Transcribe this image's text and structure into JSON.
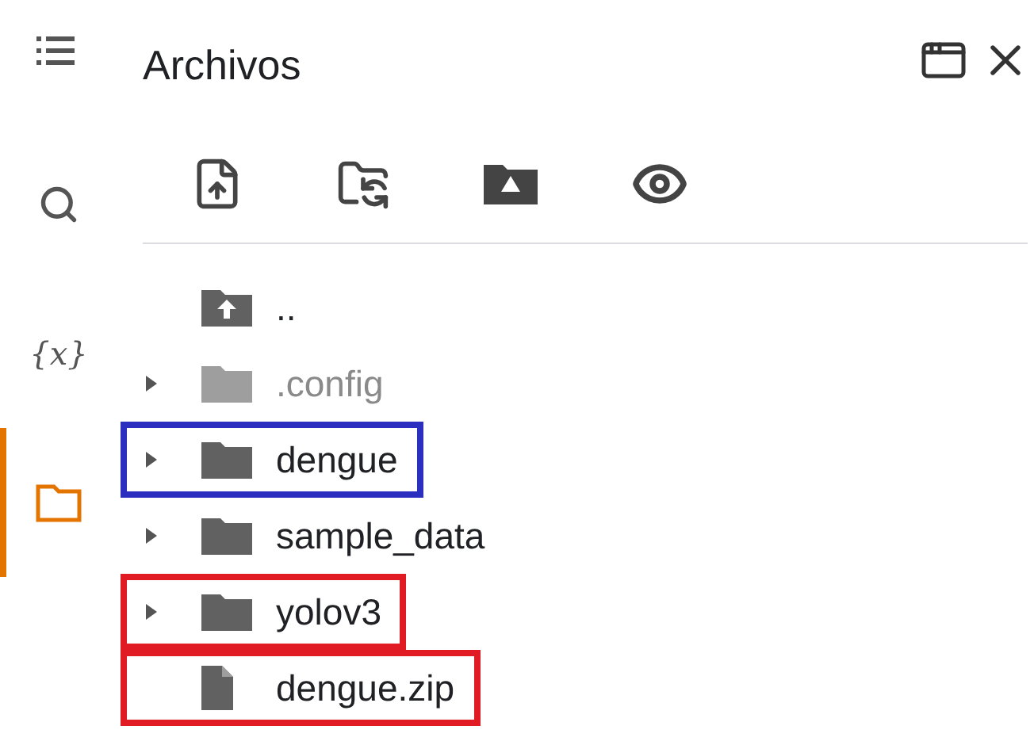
{
  "sidebar": {
    "items": [
      {
        "kind": "search",
        "selected": false
      },
      {
        "kind": "variables",
        "label": "{x}",
        "selected": false
      },
      {
        "kind": "files",
        "selected": true
      }
    ]
  },
  "panel": {
    "title": "Archivos"
  },
  "tree": [
    {
      "kind": "parent",
      "name": "..",
      "muted": false
    },
    {
      "kind": "folder",
      "name": ".config",
      "expanded": false,
      "muted": true
    },
    {
      "kind": "folder",
      "name": "dengue",
      "expanded": false,
      "muted": false,
      "color": "#2b2fc0"
    },
    {
      "kind": "folder",
      "name": "sample_data",
      "expanded": false,
      "muted": false
    },
    {
      "kind": "folder",
      "name": "yolov3",
      "expanded": false,
      "muted": false,
      "color": "#e01b24"
    },
    {
      "kind": "file",
      "name": "dengue.zip",
      "muted": false,
      "color": "#e01b24"
    }
  ]
}
